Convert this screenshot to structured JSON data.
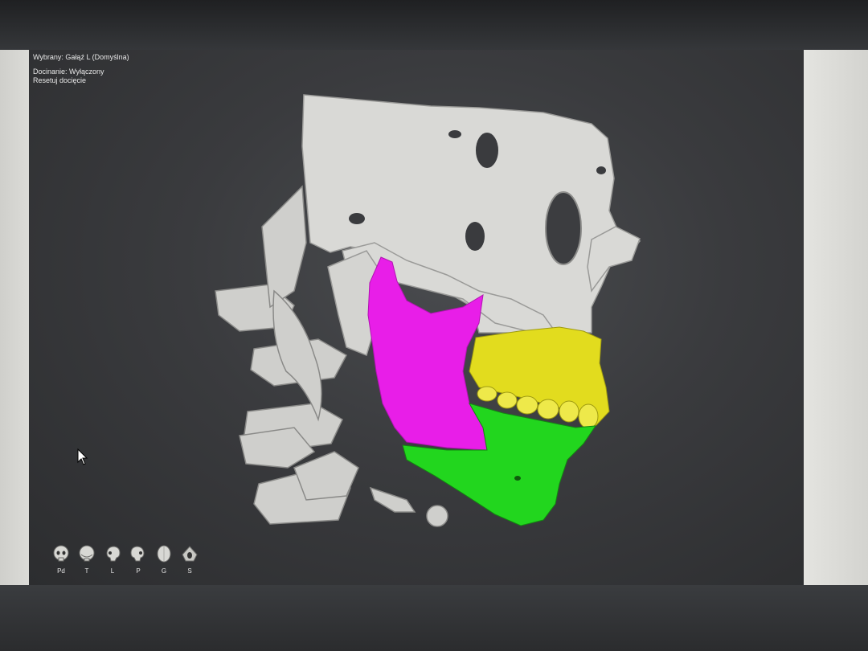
{
  "overlay": {
    "selected_text": "Wybrany: Gałąź L (Domyślna)",
    "clipping_text": "Docinanie: Wyłączony",
    "reset_clipping_text": "Resetuj docięcie"
  },
  "view_buttons": [
    {
      "label": "Pd",
      "icon": "skull-front-icon"
    },
    {
      "label": "T",
      "icon": "skull-back-icon"
    },
    {
      "label": "L",
      "icon": "skull-left-icon"
    },
    {
      "label": "P",
      "icon": "skull-right-icon"
    },
    {
      "label": "G",
      "icon": "skull-top-icon"
    },
    {
      "label": "S",
      "icon": "skull-bottom-icon"
    }
  ],
  "segment_colors": {
    "bone": "#d9d9d6",
    "ramus_left": "#e81ee8",
    "maxilla": "#e2dc1e",
    "mandible": "#22d61e"
  }
}
